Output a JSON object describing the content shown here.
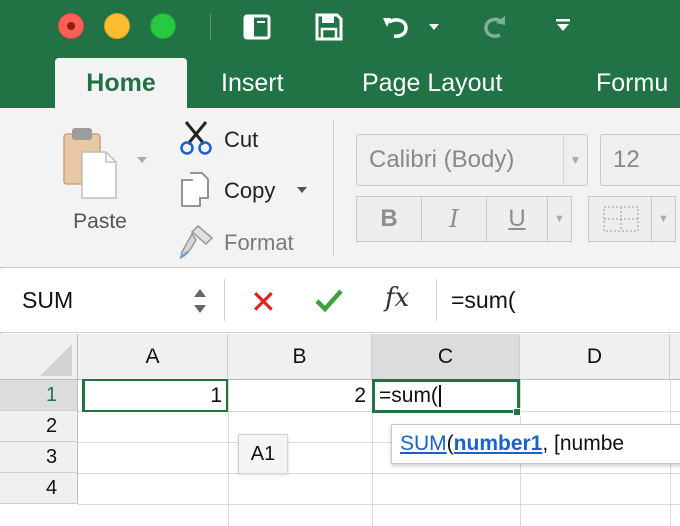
{
  "window": {
    "titlebar_color": "#217346",
    "controls": [
      "close",
      "minimize",
      "zoom"
    ]
  },
  "quick_access": {
    "icons": [
      "sidebar-icon",
      "save-icon",
      "undo-icon",
      "redo-icon",
      "customize-icon"
    ]
  },
  "ribbon": {
    "tabs": [
      {
        "label": "Home",
        "active": true
      },
      {
        "label": "Insert",
        "active": false
      },
      {
        "label": "Page Layout",
        "active": false
      },
      {
        "label": "Formu",
        "active": false
      }
    ],
    "clipboard": {
      "paste_label": "Paste",
      "cut_label": "Cut",
      "copy_label": "Copy",
      "format_label": "Format"
    },
    "font": {
      "name": "Calibri (Body)",
      "size": "12",
      "bold_label": "B",
      "italic_label": "I",
      "underline_label": "U"
    }
  },
  "formula_bar": {
    "name_box": "SUM",
    "cancel_symbol": "✕",
    "fx_label": "fx",
    "content": "=sum("
  },
  "grid": {
    "columns": [
      "A",
      "B",
      "C",
      "D"
    ],
    "selected_column": "C",
    "rows": [
      "1",
      "2",
      "3",
      "4"
    ],
    "selected_row": "1",
    "cells": {
      "A1": "1",
      "B1": "2",
      "C1": "=sum("
    }
  },
  "tooltips": {
    "reference_hint": "A1",
    "function_name": "SUM",
    "open_paren": "(",
    "arg1": "number1",
    "rest": ", [numbe"
  },
  "colors": {
    "accent": "#217346",
    "cancel": "#e2201f",
    "confirm": "#3aa23a",
    "link": "#1a62c9"
  }
}
